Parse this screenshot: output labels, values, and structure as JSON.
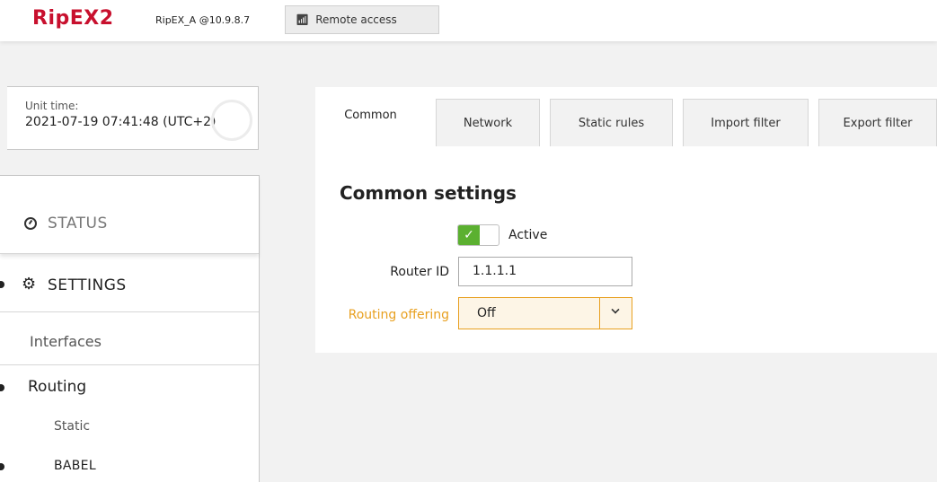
{
  "header": {
    "logo": "RipEX2",
    "unit_name": "RipEX_A @10.9.8.7",
    "remote_access_label": "Remote access",
    "remote_access_icon": "broadcast-icon"
  },
  "unit_time": {
    "label": "Unit time:",
    "value": "2021-07-19 07:41:48 (UTC+2)"
  },
  "sidebar": {
    "status": {
      "label": "STATUS",
      "icon": "gauge-icon"
    },
    "settings": {
      "label": "SETTINGS",
      "icon": "gears-icon"
    },
    "interfaces": "Interfaces",
    "routing": "Routing",
    "static": "Static",
    "babel": "BABEL"
  },
  "tabs": [
    {
      "label": "Common",
      "active": true
    },
    {
      "label": "Network",
      "active": false
    },
    {
      "label": "Static rules",
      "active": false
    },
    {
      "label": "Import filter",
      "active": false
    },
    {
      "label": "Export filter",
      "active": false
    }
  ],
  "form": {
    "title": "Common settings",
    "active_label": "Active",
    "active_checked": true,
    "router_id_label": "Router ID",
    "router_id_value": "1.1.1.1",
    "routing_offering_label": "Routing offering",
    "routing_offering_value": "Off"
  },
  "colors": {
    "brand": "#c8102e",
    "accent": "#e8a020",
    "toggle_on": "#5bb030"
  }
}
